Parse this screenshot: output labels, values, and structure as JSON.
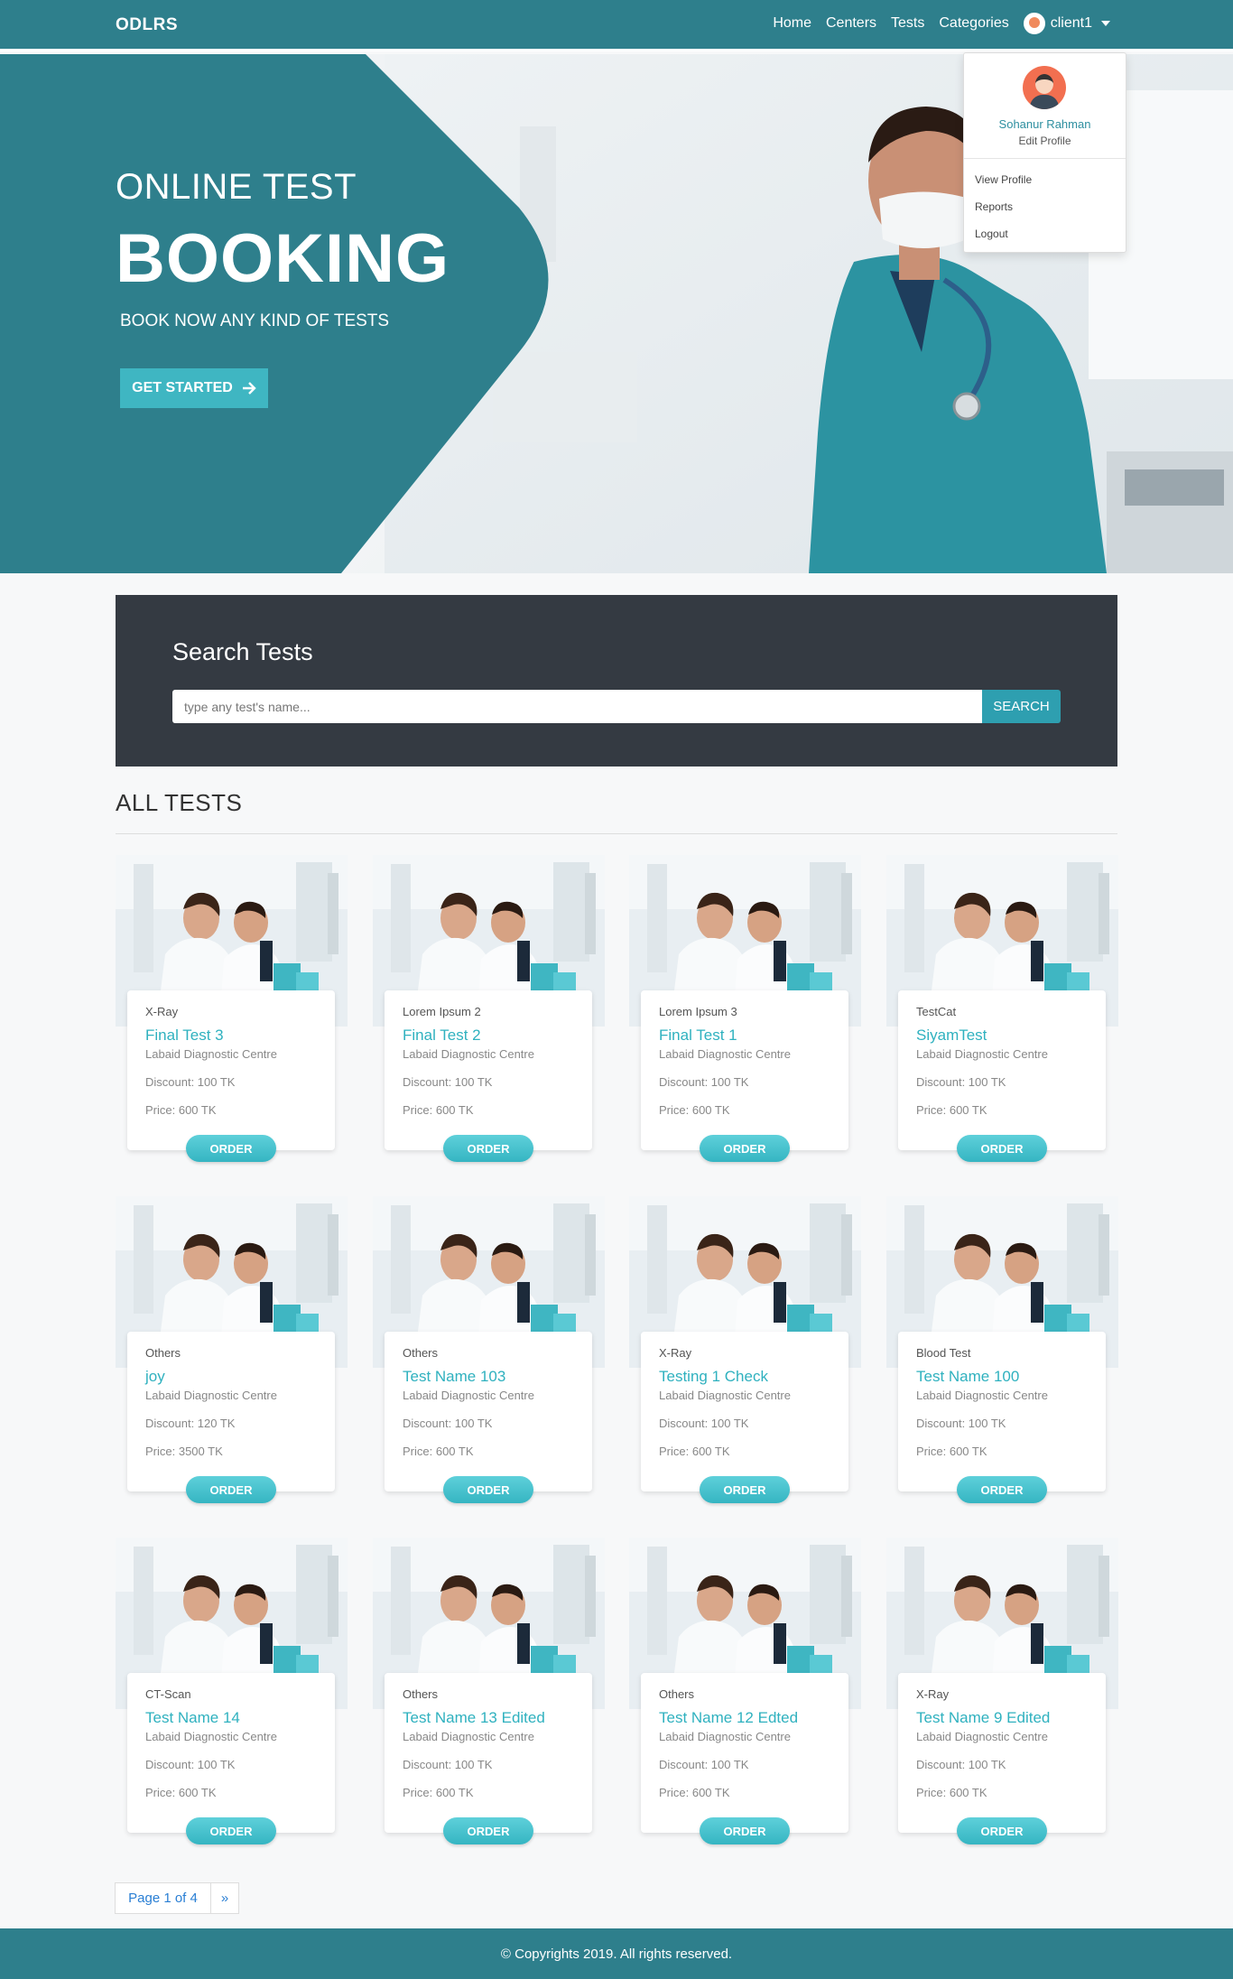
{
  "navbar": {
    "brand": "ODLRS",
    "links": [
      "Home",
      "Centers",
      "Tests",
      "Categories"
    ],
    "user": "client1"
  },
  "dropdown": {
    "name": "Sohanur Rahman",
    "edit": "Edit Profile",
    "items": [
      "View Profile",
      "Reports",
      "Logout"
    ]
  },
  "hero": {
    "subtitle": "ONLINE TEST",
    "title": "BOOKING",
    "tagline": "BOOK NOW ANY KIND OF TESTS",
    "button": "GET STARTED"
  },
  "search": {
    "title": "Search Tests",
    "placeholder": "type any test's name...",
    "button": "SEARCH"
  },
  "section": {
    "title": "ALL TESTS"
  },
  "cards": [
    {
      "category": "X-Ray",
      "name": "Final Test 3",
      "centre": "Labaid Diagnostic Centre",
      "discount": "Discount: 100 TK",
      "price": "Price: 600 TK",
      "order": "ORDER"
    },
    {
      "category": "Lorem Ipsum 2",
      "name": "Final Test 2",
      "centre": "Labaid Diagnostic Centre",
      "discount": "Discount: 100 TK",
      "price": "Price: 600 TK",
      "order": "ORDER"
    },
    {
      "category": "Lorem Ipsum 3",
      "name": "Final Test 1",
      "centre": "Labaid Diagnostic Centre",
      "discount": "Discount: 100 TK",
      "price": "Price: 600 TK",
      "order": "ORDER"
    },
    {
      "category": "TestCat",
      "name": "SiyamTest",
      "centre": "Labaid Diagnostic Centre",
      "discount": "Discount: 100 TK",
      "price": "Price: 600 TK",
      "order": "ORDER"
    },
    {
      "category": "Others",
      "name": "joy",
      "centre": "Labaid Diagnostic Centre",
      "discount": "Discount: 120 TK",
      "price": "Price: 3500 TK",
      "order": "ORDER"
    },
    {
      "category": "Others",
      "name": "Test Name 103",
      "centre": "Labaid Diagnostic Centre",
      "discount": "Discount: 100 TK",
      "price": "Price: 600 TK",
      "order": "ORDER"
    },
    {
      "category": "X-Ray",
      "name": "Testing 1 Check",
      "centre": "Labaid Diagnostic Centre",
      "discount": "Discount: 100 TK",
      "price": "Price: 600 TK",
      "order": "ORDER"
    },
    {
      "category": "Blood Test",
      "name": "Test Name 100",
      "centre": "Labaid Diagnostic Centre",
      "discount": "Discount: 100 TK",
      "price": "Price: 600 TK",
      "order": "ORDER"
    },
    {
      "category": "CT-Scan",
      "name": "Test Name 14",
      "centre": "Labaid Diagnostic Centre",
      "discount": "Discount: 100 TK",
      "price": "Price: 600 TK",
      "order": "ORDER"
    },
    {
      "category": "Others",
      "name": "Test Name 13 Edited",
      "centre": "Labaid Diagnostic Centre",
      "discount": "Discount: 100 TK",
      "price": "Price: 600 TK",
      "order": "ORDER"
    },
    {
      "category": "Others",
      "name": "Test Name 12 Edted",
      "centre": "Labaid Diagnostic Centre",
      "discount": "Discount: 100 TK",
      "price": "Price: 600 TK",
      "order": "ORDER"
    },
    {
      "category": "X-Ray",
      "name": "Test Name 9 Edited",
      "centre": "Labaid Diagnostic Centre",
      "discount": "Discount: 100 TK",
      "price": "Price: 600 TK",
      "order": "ORDER"
    }
  ],
  "pagination": {
    "page": "Page 1 of 4",
    "next": "»"
  },
  "footer": {
    "text": "© Copyrights 2019. All rights reserved."
  },
  "colors": {
    "primary": "#2e7f8c",
    "accent": "#3fb6c2",
    "dark": "#343a42"
  }
}
